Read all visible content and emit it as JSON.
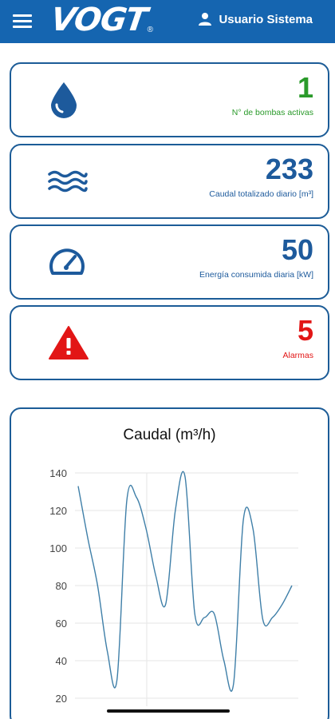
{
  "header": {
    "menu_icon": "hamburger-menu-icon",
    "logo_text": "VOGT",
    "logo_mark": "®",
    "user_icon": "user-icon",
    "user_name": "Usuario Sistema",
    "bar_color": "#1565b0"
  },
  "cards": [
    {
      "icon": "water-drop-icon",
      "value": "1",
      "label": "N° de bombas activas",
      "color": "#2a9a2a"
    },
    {
      "icon": "waves-icon",
      "value": "233",
      "label": "Caudal totalizado diario [m³]",
      "color": "#1d5a9c"
    },
    {
      "icon": "speedometer-icon",
      "value": "50",
      "label": "Energía consumida diaria [kW]",
      "color": "#1d5a9c"
    },
    {
      "icon": "warning-triangle-icon",
      "value": "5",
      "label": "Alarmas",
      "color": "#e21616"
    }
  ],
  "chart_data": {
    "type": "line",
    "title": "Caudal (m³/h)",
    "ylim": [
      20,
      140
    ],
    "yticks": [
      "140",
      "120",
      "100",
      "80",
      "60",
      "40",
      "20"
    ],
    "grid": true,
    "series": [
      {
        "color": "#3f7fa8",
        "x": [
          0,
          1,
          2,
          3,
          4,
          5,
          6,
          7,
          8,
          9,
          10,
          11,
          12,
          13,
          14,
          15,
          16,
          17,
          18,
          19,
          20,
          21,
          22
        ],
        "values": [
          133,
          105,
          80,
          45,
          30,
          125,
          127,
          110,
          85,
          70,
          120,
          138,
          65,
          63,
          65,
          40,
          28,
          115,
          110,
          62,
          63,
          70,
          80
        ]
      }
    ]
  }
}
